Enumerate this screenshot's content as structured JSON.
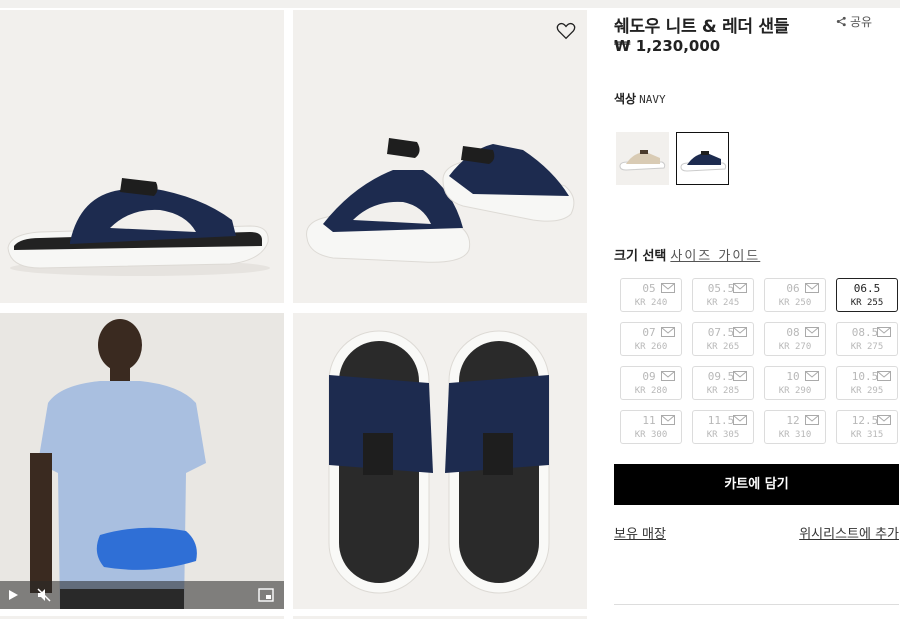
{
  "product": {
    "title": "쉐도우 니트 & 레더 샌들",
    "price": "₩ 1,230,000",
    "share_label": "공유"
  },
  "color": {
    "label": "색상",
    "value": "NAVY"
  },
  "size_section": {
    "label": "크기 선택",
    "guide_label": "사이즈 가이드"
  },
  "sizes": [
    {
      "eu": "05",
      "kr": "KR 240"
    },
    {
      "eu": "05.5",
      "kr": "KR 245"
    },
    {
      "eu": "06",
      "kr": "KR 250"
    },
    {
      "eu": "06.5",
      "kr": "KR 255"
    },
    {
      "eu": "07",
      "kr": "KR 260"
    },
    {
      "eu": "07.5",
      "kr": "KR 265"
    },
    {
      "eu": "08",
      "kr": "KR 270"
    },
    {
      "eu": "08.5",
      "kr": "KR 275"
    },
    {
      "eu": "09",
      "kr": "KR 280"
    },
    {
      "eu": "09.5",
      "kr": "KR 285"
    },
    {
      "eu": "10",
      "kr": "KR 290"
    },
    {
      "eu": "10.5",
      "kr": "KR 295"
    },
    {
      "eu": "11",
      "kr": "KR 300"
    },
    {
      "eu": "11.5",
      "kr": "KR 305"
    },
    {
      "eu": "12",
      "kr": "KR 310"
    },
    {
      "eu": "12.5",
      "kr": "KR 315"
    }
  ],
  "actions": {
    "cart_label": "카트에 담기",
    "store_label": "보유 매장",
    "wishlist_label": "위시리스트에 추가"
  },
  "icons": {
    "heart": "heart-icon",
    "share": "share-icon",
    "play": "play-icon",
    "mute": "mute-icon",
    "pip": "picture-in-picture-icon",
    "mail": "mail-icon"
  },
  "colors": {
    "navy": "#1d2b4f",
    "sole_white": "#f4f4f2",
    "strap_black": "#1e1e1e",
    "shirt_blue": "#a9bfe0",
    "towel_blue": "#2f6fd6",
    "button_black": "#000000"
  }
}
